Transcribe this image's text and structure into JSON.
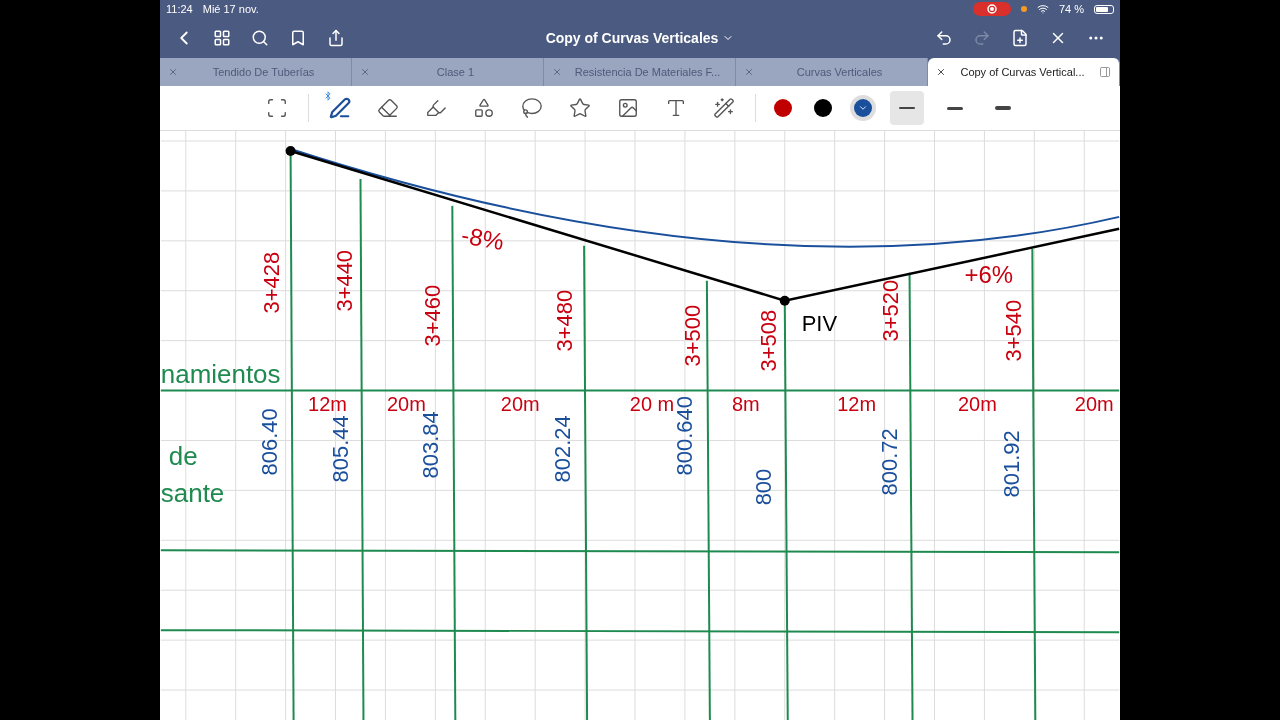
{
  "status_bar": {
    "time": "11:24",
    "date": "Mié 17 nov.",
    "recording": true,
    "battery": "74 %"
  },
  "nav": {
    "title": "Copy of Curvas Verticales",
    "redo_disabled": true
  },
  "tabs": [
    {
      "label": "Tendido De Tuberías",
      "selected": false
    },
    {
      "label": "Clase 1",
      "selected": false
    },
    {
      "label": "Resistencia De Materiales F...",
      "selected": false
    },
    {
      "label": "Curvas Verticales",
      "selected": false
    },
    {
      "label": "Copy of Curvas Vertical...",
      "selected": true
    }
  ],
  "toolbar": {
    "tools": [
      {
        "kind": "scan",
        "selected": false
      },
      {
        "kind": "pen",
        "selected": true
      },
      {
        "kind": "eraser",
        "selected": false
      },
      {
        "kind": "highlighter",
        "selected": false
      },
      {
        "kind": "shapes",
        "selected": false
      },
      {
        "kind": "lasso",
        "selected": false
      },
      {
        "kind": "sticker",
        "selected": false
      },
      {
        "kind": "image",
        "selected": false
      },
      {
        "kind": "text",
        "selected": false
      },
      {
        "kind": "laser",
        "selected": false
      }
    ],
    "colors": [
      {
        "color": "#c00000",
        "selected": false
      },
      {
        "color": "#000000",
        "selected": false
      },
      {
        "color": "#1a4f9c",
        "selected": true
      }
    ],
    "widths": [
      {
        "kind": "thin",
        "selected": true
      },
      {
        "kind": "medium",
        "selected": false
      },
      {
        "kind": "thick",
        "selected": false
      }
    ]
  },
  "canvas": {
    "side_labels": [
      "namientos",
      "de",
      "sante"
    ],
    "stations": [
      "3+428",
      "3+440",
      "3+460",
      "3+480",
      "3+500",
      "3+508",
      "3+520",
      "3+540"
    ],
    "distances": [
      "12m",
      "20m",
      "20m",
      "20 m",
      "8m",
      "12m",
      "20m",
      "20m"
    ],
    "elevations": [
      "806.40",
      "805.44",
      "803.84",
      "802.24",
      "800.640",
      "800",
      "800.72",
      "801.92"
    ],
    "grades": [
      "-8%",
      "+6%"
    ],
    "point_label": "PIV"
  }
}
